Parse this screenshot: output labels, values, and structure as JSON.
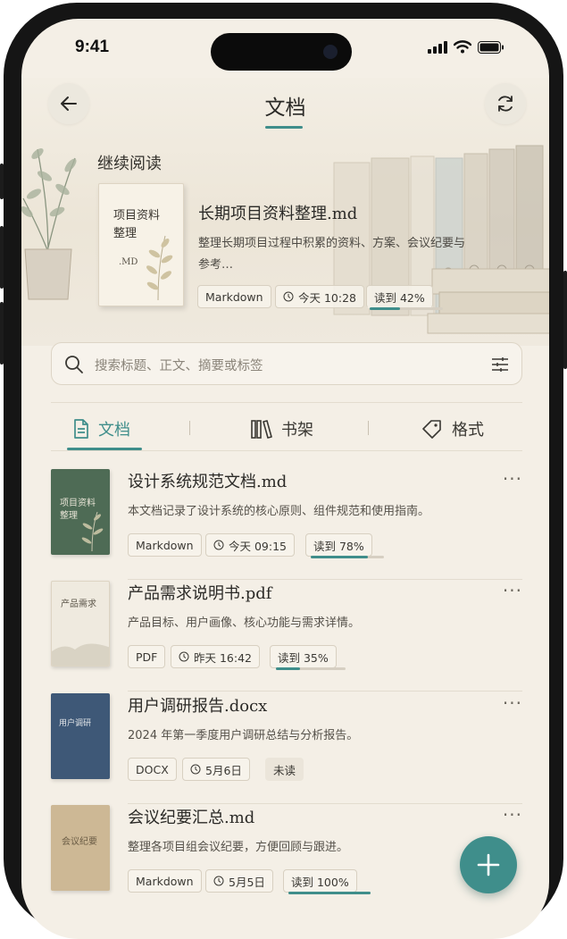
{
  "status_bar": {
    "time": "9:41"
  },
  "header": {
    "title": "文档"
  },
  "continue_reading": {
    "section_title": "继续阅读",
    "cover_title": "项目资料整理",
    "cover_ext": ".MD",
    "title": "长期项目资料整理.md",
    "description": "整理长期项目过程中积累的资料、方案、会议纪要与参考…",
    "format": "Markdown",
    "time": "今天 10:28",
    "progress_label": "读到 42%",
    "progress": 0.42
  },
  "search": {
    "placeholder": "搜索标题、正文、摘要或标签"
  },
  "tabs": [
    {
      "label": "文档",
      "icon": "document-icon",
      "active": true
    },
    {
      "label": "书架",
      "icon": "bookshelf-icon",
      "active": false
    },
    {
      "label": "格式",
      "icon": "tag-icon",
      "active": false
    }
  ],
  "documents": [
    {
      "title": "设计系统规范文档.md",
      "description": "本文档记录了设计系统的核心原则、组件规范和使用指南。",
      "format": "Markdown",
      "time": "今天 09:15",
      "status": "读到 78%",
      "progress": 0.78,
      "cover_text": "项目资料\n整理",
      "cover_color": "#4e6b55"
    },
    {
      "title": "产品需求说明书.pdf",
      "description": "产品目标、用户画像、核心功能与需求详情。",
      "format": "PDF",
      "time": "昨天 16:42",
      "status": "读到 35%",
      "progress": 0.35,
      "cover_text": "产品需求",
      "cover_color": "#efeadf"
    },
    {
      "title": "用户调研报告.docx",
      "description": "2024 年第一季度用户调研总结与分析报告。",
      "format": "DOCX",
      "time": "5月6日",
      "status": "未读",
      "progress": null,
      "cover_text": "用户调研",
      "cover_color": "#3e5877"
    },
    {
      "title": "会议纪要汇总.md",
      "description": "整理各项目组会议纪要，方便回顾与跟进。",
      "format": "Markdown",
      "time": "5月5日",
      "status": "读到 100%",
      "progress": 1.0,
      "cover_text": "会议纪要",
      "cover_color": "#cdb895"
    }
  ],
  "accent_color": "#3f8e8b"
}
